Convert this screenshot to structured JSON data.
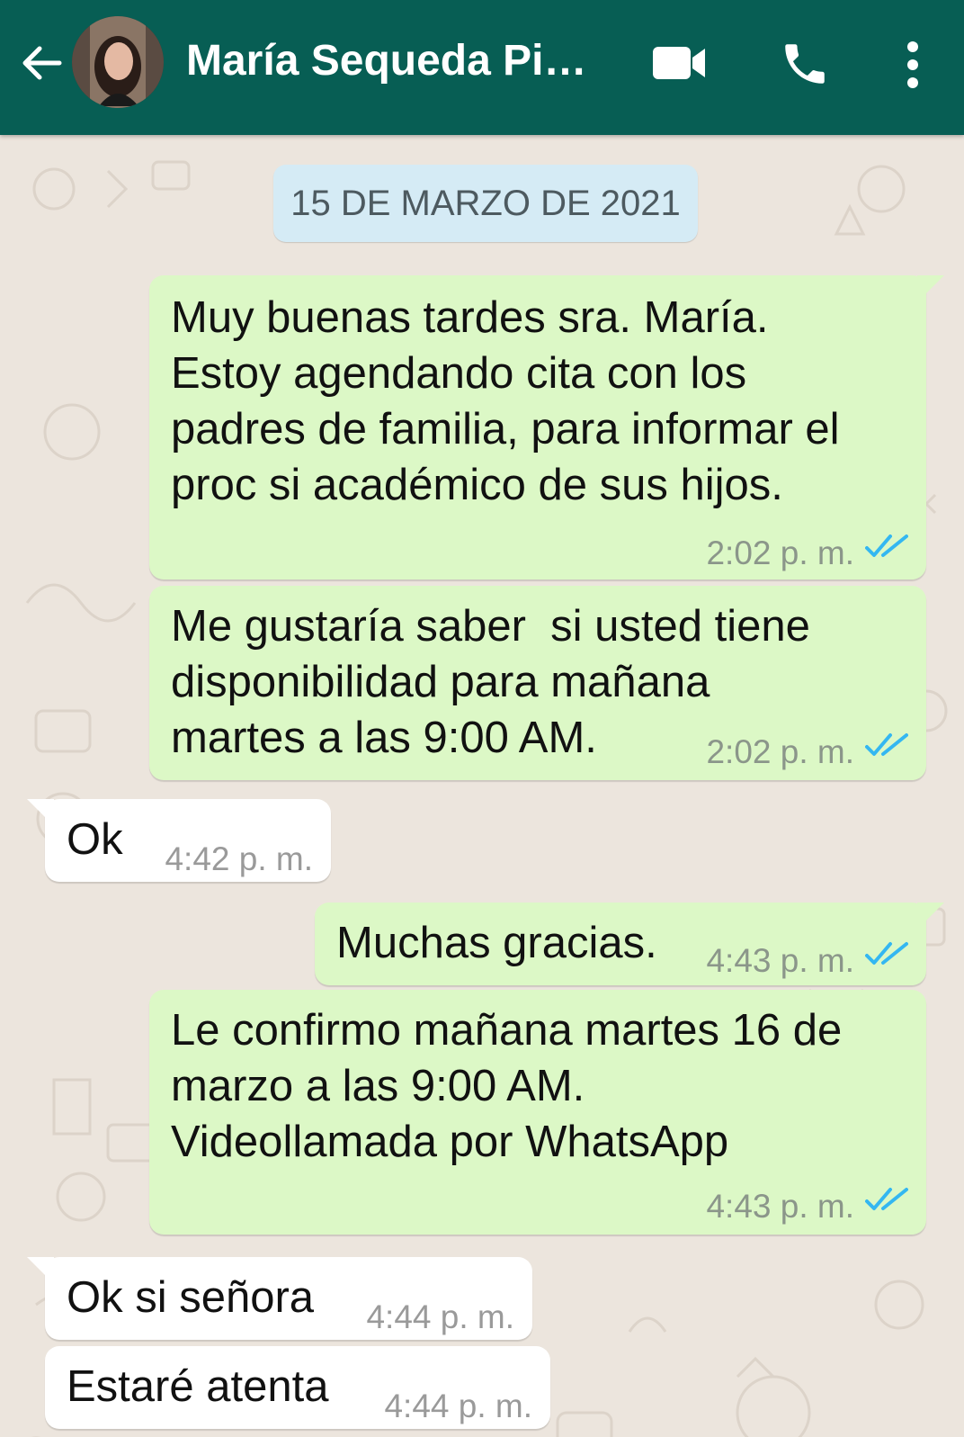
{
  "header": {
    "contact_name": "María Sequeda Pi…",
    "icons": [
      "back-arrow-icon",
      "avatar",
      "video-call-icon",
      "phone-icon",
      "more-options-icon"
    ]
  },
  "date_chip": "15 DE MARZO DE 2021",
  "messages": [
    {
      "direction": "out",
      "lines": [
        "Muy buenas tardes sra. María.",
        "Estoy agendando cita con los",
        "padres de familia, para informar el",
        "proc si académico de sus hijos."
      ],
      "time": "2:02 p. m.",
      "status": "read"
    },
    {
      "direction": "out",
      "lines": [
        "Me gustaría saber  si usted tiene",
        "disponibilidad para mañana",
        "martes a las 9:00 AM."
      ],
      "time": "2:02 p. m.",
      "status": "read"
    },
    {
      "direction": "in",
      "lines": [
        "Ok"
      ],
      "time": "4:42 p. m."
    },
    {
      "direction": "out",
      "lines": [
        "Muchas gracias."
      ],
      "time": "4:43 p. m.",
      "status": "read"
    },
    {
      "direction": "out",
      "lines": [
        "Le confirmo mañana martes 16 de",
        "marzo a las 9:00 AM.",
        "Videollamada por WhatsApp"
      ],
      "time": "4:43 p. m.",
      "status": "read"
    },
    {
      "direction": "in",
      "lines": [
        "Ok si señora"
      ],
      "time": "4:44 p. m."
    },
    {
      "direction": "in",
      "lines": [
        "Estaré atenta"
      ],
      "time": "4:44 p. m."
    }
  ],
  "colors": {
    "header": "#075e54",
    "outgoing": "#dcf8c6",
    "incoming": "#ffffff",
    "chat_bg": "#ece5dd",
    "read_tick": "#34b7f1"
  }
}
